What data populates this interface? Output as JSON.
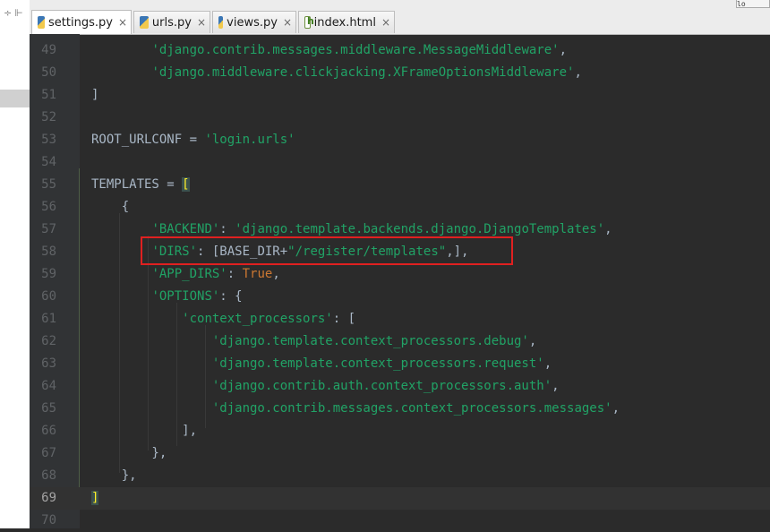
{
  "tabs": [
    {
      "label": "settings.py",
      "icon": "python-file-icon",
      "active": true
    },
    {
      "label": "urls.py",
      "icon": "python-file-icon",
      "active": false
    },
    {
      "label": "views.py",
      "icon": "python-file-icon",
      "active": false
    },
    {
      "label": "index.html",
      "icon": "html-file-icon",
      "active": false
    }
  ],
  "tab_close_glyph": "×",
  "left_toolbar": {
    "collapse_glyph": "÷",
    "pin_glyph": "⊩"
  },
  "corner_label": "lo",
  "current_line": "69",
  "lines": [
    {
      "n": "49",
      "tokens": [
        {
          "t": "        ",
          "c": "b"
        },
        {
          "t": "'django.contrib.messages.middleware.MessageMiddleware'",
          "c": "s"
        },
        {
          "t": ",",
          "c": "b"
        }
      ]
    },
    {
      "n": "50",
      "tokens": [
        {
          "t": "        ",
          "c": "b"
        },
        {
          "t": "'django.middleware.clickjacking.XFrameOptionsMiddleware'",
          "c": "s"
        },
        {
          "t": ",",
          "c": "b"
        }
      ]
    },
    {
      "n": "51",
      "tokens": [
        {
          "t": "]",
          "c": "b"
        }
      ]
    },
    {
      "n": "52",
      "tokens": []
    },
    {
      "n": "53",
      "tokens": [
        {
          "t": "ROOT_URLCONF = ",
          "c": "b"
        },
        {
          "t": "'login.urls'",
          "c": "s"
        }
      ]
    },
    {
      "n": "54",
      "tokens": []
    },
    {
      "n": "55",
      "tokens": [
        {
          "t": "TEMPLATES = ",
          "c": "b"
        },
        {
          "t": "[",
          "c": "caret"
        }
      ]
    },
    {
      "n": "56",
      "tokens": [
        {
          "t": "    {",
          "c": "b"
        }
      ]
    },
    {
      "n": "57",
      "tokens": [
        {
          "t": "        ",
          "c": "b"
        },
        {
          "t": "'BACKEND'",
          "c": "s"
        },
        {
          "t": ": ",
          "c": "b"
        },
        {
          "t": "'django.template.backends.django.DjangoTemplates'",
          "c": "s"
        },
        {
          "t": ",",
          "c": "b"
        }
      ]
    },
    {
      "n": "58",
      "tokens": [
        {
          "t": "        ",
          "c": "b"
        },
        {
          "t": "'DIRS'",
          "c": "s"
        },
        {
          "t": ": [BASE_DIR+",
          "c": "b"
        },
        {
          "t": "\"/register/templates\"",
          "c": "s"
        },
        {
          "t": ",],",
          "c": "b"
        }
      ]
    },
    {
      "n": "59",
      "tokens": [
        {
          "t": "        ",
          "c": "b"
        },
        {
          "t": "'APP_DIRS'",
          "c": "s"
        },
        {
          "t": ": ",
          "c": "b"
        },
        {
          "t": "True",
          "c": "k"
        },
        {
          "t": ",",
          "c": "b"
        }
      ]
    },
    {
      "n": "60",
      "tokens": [
        {
          "t": "        ",
          "c": "b"
        },
        {
          "t": "'OPTIONS'",
          "c": "s"
        },
        {
          "t": ": {",
          "c": "b"
        }
      ]
    },
    {
      "n": "61",
      "tokens": [
        {
          "t": "            ",
          "c": "b"
        },
        {
          "t": "'context_processors'",
          "c": "s"
        },
        {
          "t": ": [",
          "c": "b"
        }
      ]
    },
    {
      "n": "62",
      "tokens": [
        {
          "t": "                ",
          "c": "b"
        },
        {
          "t": "'django.template.context_processors.debug'",
          "c": "s"
        },
        {
          "t": ",",
          "c": "b"
        }
      ]
    },
    {
      "n": "63",
      "tokens": [
        {
          "t": "                ",
          "c": "b"
        },
        {
          "t": "'django.template.context_processors.request'",
          "c": "s"
        },
        {
          "t": ",",
          "c": "b"
        }
      ]
    },
    {
      "n": "64",
      "tokens": [
        {
          "t": "                ",
          "c": "b"
        },
        {
          "t": "'django.contrib.auth.context_processors.auth'",
          "c": "s"
        },
        {
          "t": ",",
          "c": "b"
        }
      ]
    },
    {
      "n": "65",
      "tokens": [
        {
          "t": "                ",
          "c": "b"
        },
        {
          "t": "'django.contrib.messages.context_processors.messages'",
          "c": "s"
        },
        {
          "t": ",",
          "c": "b"
        }
      ]
    },
    {
      "n": "66",
      "tokens": [
        {
          "t": "            ],",
          "c": "b"
        }
      ]
    },
    {
      "n": "67",
      "tokens": [
        {
          "t": "        },",
          "c": "b"
        }
      ]
    },
    {
      "n": "68",
      "tokens": [
        {
          "t": "    },",
          "c": "b"
        }
      ]
    },
    {
      "n": "69",
      "tokens": [
        {
          "t": "]",
          "c": "caret"
        }
      ]
    },
    {
      "n": "70",
      "tokens": []
    }
  ],
  "colors": {
    "string": "#21a366",
    "keyword": "#cc7832",
    "default_text": "#a9b7c6",
    "line_number": "#606366",
    "editor_bg": "#2b2b2b",
    "highlight_box": "#e02020"
  }
}
